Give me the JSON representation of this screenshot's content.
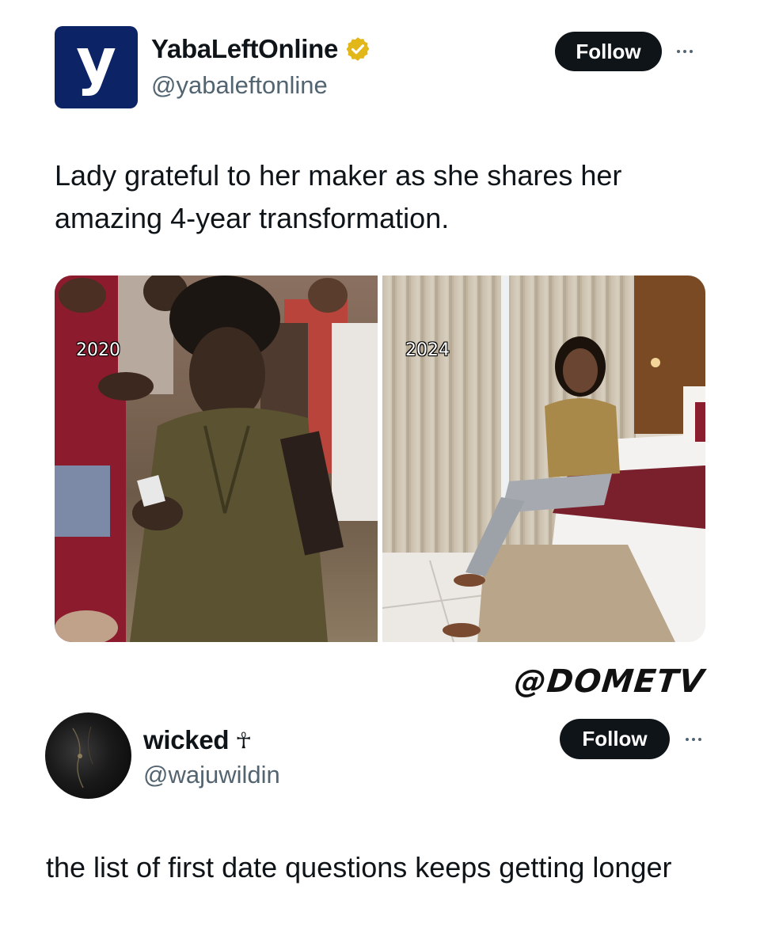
{
  "posts": [
    {
      "author": {
        "display_name": "YabaLeftOnline",
        "handle": "@yabaleftonline",
        "verified": true,
        "logo_letter": "y"
      },
      "follow_label": "Follow",
      "text": "Lady grateful to her maker as she shares her amazing 4-year transformation.",
      "media": {
        "labels": [
          "2020",
          "2024"
        ]
      },
      "watermark": "@DOMETV"
    },
    {
      "author": {
        "display_name": "wicked",
        "name_symbol": "☥",
        "handle": "@wajuwildin"
      },
      "follow_label": "Follow",
      "text": "the list of first date questions keeps getting longer"
    }
  ],
  "colors": {
    "follow_bg": "#0f1419",
    "follow_text": "#ffffff",
    "handle": "#536471",
    "verified_badge": "#e2b719",
    "logo_bg": "#0c2466"
  },
  "icons": [
    "more-icon",
    "verified-badge-icon"
  ]
}
